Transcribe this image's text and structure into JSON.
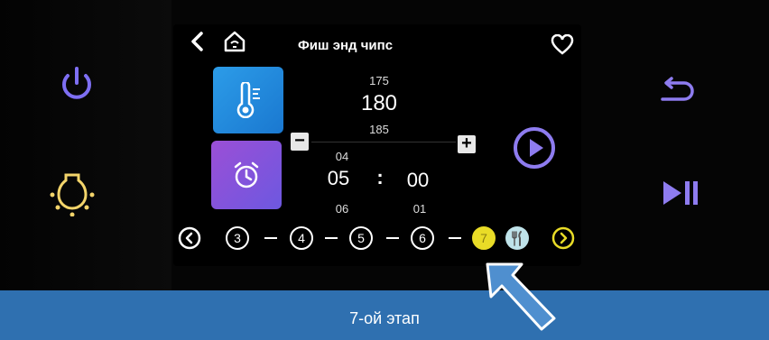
{
  "header": {
    "title": "Фиш энд чипс"
  },
  "temperature": {
    "prev": "175",
    "current": "180",
    "next": "185"
  },
  "timer": {
    "minutes_prev": "04",
    "minutes": "05",
    "minutes_next": "06",
    "separator": ":",
    "seconds": "00",
    "seconds_next": "01"
  },
  "controls": {
    "minus": "−",
    "plus": "+"
  },
  "steps": {
    "s3": "3",
    "s4": "4",
    "s5": "5",
    "s6": "6",
    "s7": "7"
  },
  "banner": {
    "text": "7-ой этап"
  },
  "colors": {
    "accent_purple": "#8e7cf0",
    "power_purple": "#7e6ff3",
    "bulb_yellow": "#f3d46a",
    "active_step_yellow": "#e9dc27",
    "banner_blue": "#2f70b0",
    "pointer_blue": "#4f8fcf"
  },
  "icons": {
    "power": "power-icon",
    "light": "lightbulb-icon",
    "back_arrow": "back-arrow-icon",
    "home": "home-icon",
    "favorite": "heart-icon",
    "thermometer": "thermometer-icon",
    "alarm": "alarm-clock-icon",
    "play": "play-icon",
    "undo": "undo-icon",
    "play_pause": "play-pause-icon",
    "cutlery": "cutlery-icon",
    "pointer": "pointer-arrow-icon"
  }
}
